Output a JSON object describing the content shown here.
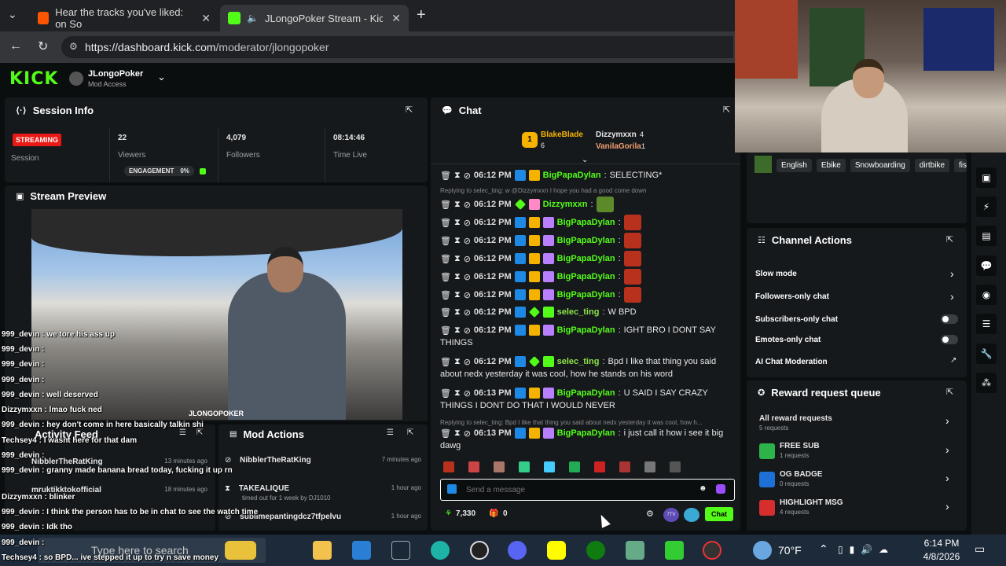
{
  "browser": {
    "tabs": [
      {
        "title": "Hear the tracks you've liked: on So",
        "active": false
      },
      {
        "title": "JLongoPoker Stream - Kick Da",
        "active": true
      }
    ],
    "url_host": "https://dashboard.kick.com",
    "url_path": "/moderator/jlongopoker"
  },
  "header": {
    "logo": "KICK",
    "channel": "JLongoPoker",
    "access": "Mod Access"
  },
  "session": {
    "title": "Session Info",
    "status": "STREAMING",
    "status_label": "Session",
    "viewers": "22",
    "viewers_label": "Viewers",
    "engagement_label": "ENGAGEMENT",
    "engagement_value": "0%",
    "followers": "4,079",
    "followers_label": "Followers",
    "time_live": "08:14:46",
    "time_live_label": "Time Live"
  },
  "preview": {
    "title": "Stream Preview",
    "watermark": "JLONGOPOKER"
  },
  "activity": {
    "title": "Activity Feed",
    "items": [
      {
        "user": "NibblerTheRatKing",
        "time": "13 minutes ago"
      },
      {
        "user": "mruktikktokofficial",
        "time": "18 minutes ago"
      }
    ]
  },
  "mod_actions": {
    "title": "Mod Actions",
    "items": [
      {
        "user": "NibblerTheRatKing",
        "time": "7 minutes ago"
      },
      {
        "user": "TAKEALIQUE",
        "detail": "timed out for 1 week by DJ1010",
        "time": "1 hour ago"
      },
      {
        "user": "sublimepantingdcz7tfpelvu",
        "time": "1 hour ago"
      }
    ]
  },
  "chat": {
    "title": "Chat",
    "top_users": [
      {
        "name": "BlakeBlade",
        "count": "6"
      },
      {
        "name": "Dizzymxxn",
        "count": "4"
      },
      {
        "name": "VanilaGorila",
        "count": "1"
      }
    ],
    "messages": [
      {
        "time": "06:12 PM",
        "user": "BigPapaDylan",
        "text": "SELECTING*"
      },
      {
        "reply": "Replying to selec_ting: w @Dizzymxxn I hope you had a good come down"
      },
      {
        "time": "06:12 PM",
        "user": "Dizzymxxn",
        "text": ""
      },
      {
        "time": "06:12 PM",
        "user": "BigPapaDylan",
        "text": ""
      },
      {
        "time": "06:12 PM",
        "user": "BigPapaDylan",
        "text": ""
      },
      {
        "time": "06:12 PM",
        "user": "BigPapaDylan",
        "text": ""
      },
      {
        "time": "06:12 PM",
        "user": "BigPapaDylan",
        "text": ""
      },
      {
        "time": "06:12 PM",
        "user": "BigPapaDylan",
        "text": ""
      },
      {
        "time": "06:12 PM",
        "user": "selec_ting",
        "text": "W BPD"
      },
      {
        "time": "06:12 PM",
        "user": "BigPapaDylan",
        "text": "IGHT BRO I DONT SAY",
        "text2": "THINGS"
      },
      {
        "time": "06:12 PM",
        "user": "selec_ting",
        "text": "Bpd I like that thing you said",
        "text2": "about nedx yesterday it was cool, how he stands on his word"
      },
      {
        "time": "06:13 PM",
        "user": "BigPapaDylan",
        "text": "U SAID I SAY CRAZY",
        "text2": "THINGS I DONT DO THAT I WOULD NEVER"
      },
      {
        "reply": "Replying to selec_ting: Bpd I like that thing you said about nedx yesterday it was cool, how h..."
      },
      {
        "time": "06:13 PM",
        "user": "BigPapaDylan",
        "text": "i just call it how i see it big",
        "text2": "dawg"
      }
    ],
    "input_placeholder": "Send a message",
    "points": "7,330",
    "gifts": "0",
    "send_label": "Chat",
    "badge_7tv": "7TV"
  },
  "profile_tags": [
    "English",
    "Ebike",
    "Snowboarding",
    "dirtbike",
    "fis"
  ],
  "channel_actions": {
    "title": "Channel Actions",
    "items": [
      "Slow mode",
      "Followers-only chat",
      "Subscribers-only chat",
      "Emotes-only chat",
      "AI Chat Moderation"
    ]
  },
  "rewards": {
    "title": "Reward request queue",
    "items": [
      {
        "name": "All reward requests",
        "count": "5 requests"
      },
      {
        "name": "FREE SUB",
        "count": "1 requests"
      },
      {
        "name": "OG BADGE",
        "count": "0 requests"
      },
      {
        "name": "HIGHLIGHT MSG",
        "count": "4 requests"
      }
    ]
  },
  "overlay_chat": [
    {
      "user": "999_devin",
      "text": "we tore his ass up"
    },
    {
      "user": "999_devin",
      "text": ""
    },
    {
      "user": "999_devin",
      "text": ""
    },
    {
      "user": "999_devin",
      "text": ""
    },
    {
      "user": "999_devin",
      "text": "well deserved"
    },
    {
      "user": "Dizzymxxn",
      "text": "lmao fuck ned"
    },
    {
      "user": "999_devin",
      "text": "hey don't come in here basically talkin shi"
    },
    {
      "user": "Techsey4",
      "text": "I wasnt here for that dam"
    },
    {
      "user": "999_devin",
      "text": ""
    },
    {
      "user": "999_devin",
      "text": "granny made banana bread today, fucking it up rn"
    },
    {
      "user": "Dizzymxxn",
      "text": "blinker"
    },
    {
      "user": "999_devin",
      "text": "I think the person has to be in chat to see the watch time"
    },
    {
      "user": "999_devin",
      "text": "Idk tho"
    },
    {
      "user": "999_devin",
      "text": ""
    },
    {
      "user": "Techsey4",
      "text": "so BPD... ive stepped it up to try n save money"
    }
  ],
  "taskbar": {
    "search_placeholder": "Type here to search",
    "weather": "70°F",
    "time": "6:14 PM",
    "date": "4/8/2026"
  }
}
